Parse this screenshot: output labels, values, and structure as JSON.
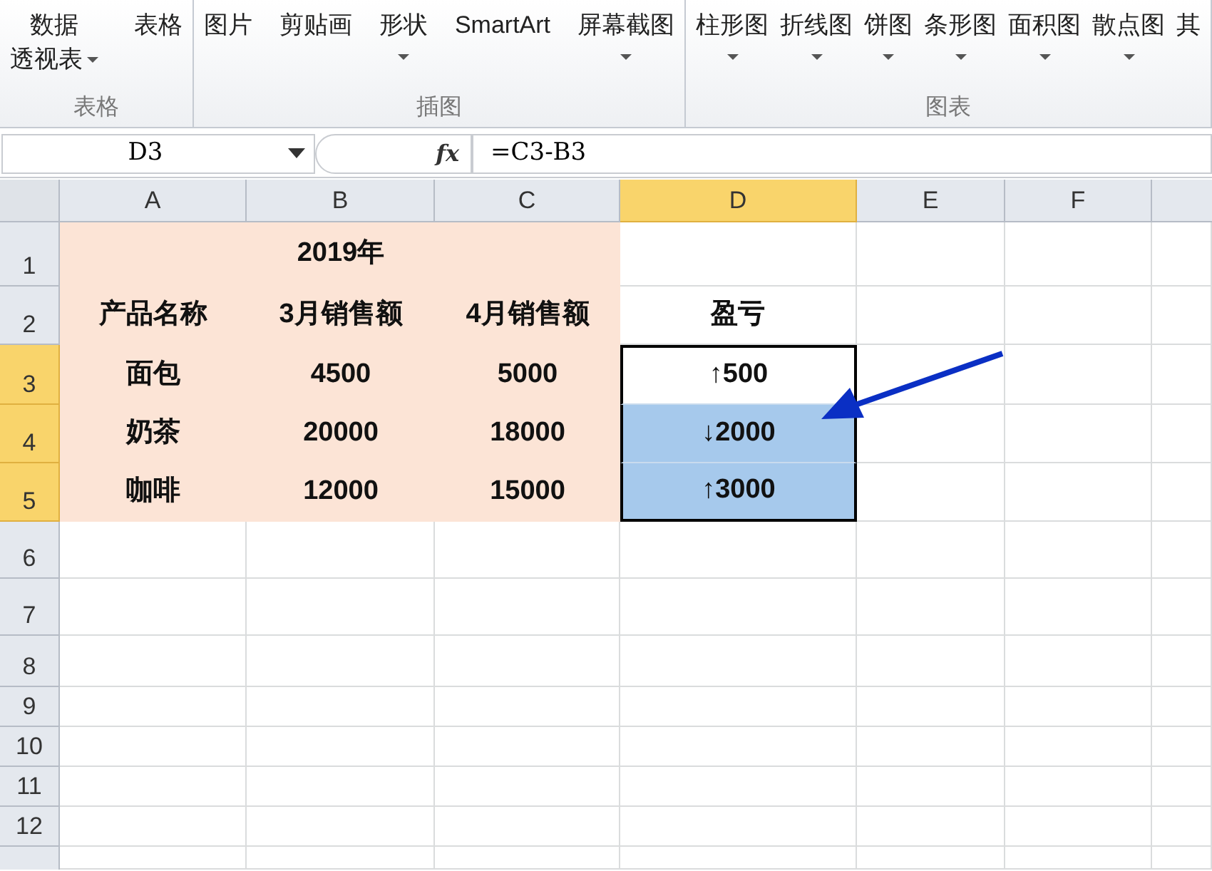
{
  "ribbon": {
    "groups": [
      {
        "label": "表格",
        "buttons": [
          {
            "lines": [
              "数据",
              "透视表"
            ],
            "dropdown": true
          },
          {
            "lines": [
              "表格"
            ],
            "dropdown": false
          }
        ]
      },
      {
        "label": "插图",
        "buttons": [
          {
            "lines": [
              "图片"
            ],
            "dropdown": false
          },
          {
            "lines": [
              "剪贴画"
            ],
            "dropdown": false
          },
          {
            "lines": [
              "形状"
            ],
            "dropdown": true
          },
          {
            "lines": [
              "SmartArt"
            ],
            "dropdown": false
          },
          {
            "lines": [
              "屏幕截图"
            ],
            "dropdown": true
          }
        ]
      },
      {
        "label": "图表",
        "buttons": [
          {
            "lines": [
              "柱形图"
            ],
            "dropdown": true
          },
          {
            "lines": [
              "折线图"
            ],
            "dropdown": true
          },
          {
            "lines": [
              "饼图"
            ],
            "dropdown": true
          },
          {
            "lines": [
              "条形图"
            ],
            "dropdown": true
          },
          {
            "lines": [
              "面积图"
            ],
            "dropdown": true
          },
          {
            "lines": [
              "散点图"
            ],
            "dropdown": true
          },
          {
            "lines": [
              "其"
            ],
            "dropdown": false
          }
        ]
      }
    ]
  },
  "formula_bar": {
    "name_box": "D3",
    "function_label": "fx",
    "formula": "=C3-B3"
  },
  "sheet": {
    "columns": [
      {
        "label": "A",
        "selected": false
      },
      {
        "label": "B",
        "selected": false
      },
      {
        "label": "C",
        "selected": false
      },
      {
        "label": "D",
        "selected": true
      },
      {
        "label": "E",
        "selected": false
      },
      {
        "label": "F",
        "selected": false
      }
    ],
    "rows": [
      {
        "label": "1",
        "selected": false,
        "cells": [
          {
            "shaded": true
          },
          {
            "text": "2019年",
            "shaded": true
          },
          {
            "shaded": true
          },
          {
            "shaded": false
          }
        ]
      },
      {
        "label": "2",
        "selected": false,
        "cells": [
          {
            "text": "产品名称",
            "shaded": true
          },
          {
            "text": "3月销售额",
            "shaded": true
          },
          {
            "text": "4月销售额",
            "shaded": true
          },
          {
            "text": "盈亏",
            "shaded": false
          }
        ]
      },
      {
        "label": "3",
        "selected": true,
        "cells": [
          {
            "text": "面包",
            "shaded": true
          },
          {
            "text": "4500",
            "shaded": true
          },
          {
            "text": "5000",
            "shaded": true
          },
          {
            "text": "↑500",
            "shaded": false,
            "in_selection": true,
            "active": true
          }
        ]
      },
      {
        "label": "4",
        "selected": true,
        "cells": [
          {
            "text": "奶茶",
            "shaded": true
          },
          {
            "text": "20000",
            "shaded": true
          },
          {
            "text": "18000",
            "shaded": true
          },
          {
            "text": "↓2000",
            "shaded": false,
            "in_selection": true,
            "active": false
          }
        ]
      },
      {
        "label": "5",
        "selected": true,
        "cells": [
          {
            "text": "咖啡",
            "shaded": true
          },
          {
            "text": "12000",
            "shaded": true
          },
          {
            "text": "15000",
            "shaded": true
          },
          {
            "text": "↑3000",
            "shaded": false,
            "in_selection": true,
            "active": false
          }
        ]
      },
      {
        "label": "6",
        "selected": false
      },
      {
        "label": "7",
        "selected": false
      },
      {
        "label": "8",
        "selected": false
      },
      {
        "label": "9",
        "selected": false
      },
      {
        "label": "10",
        "selected": false
      },
      {
        "label": "11",
        "selected": false
      },
      {
        "label": "12",
        "selected": false
      }
    ]
  }
}
